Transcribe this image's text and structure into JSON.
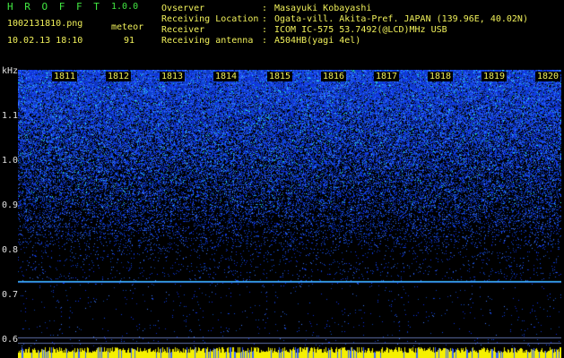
{
  "header": {
    "app_title": "H R O F F T",
    "app_version": "1.0.0",
    "file_name": "1002131810.png",
    "meteor_label": "meteor",
    "date_time": "10.02.13 18:10",
    "meteor_count": "91"
  },
  "info": [
    {
      "label": "Ovserver",
      "value": "Masayuki Kobayashi"
    },
    {
      "label": "Receiving Location",
      "value": "Ogata-vill. Akita-Pref. JAPAN (139.96E, 40.02N)"
    },
    {
      "label": "Receiver",
      "value": "ICOM IC-575 53.7492(@LCD)MHz USB"
    },
    {
      "label": "Receiving antenna",
      "value": "A504HB(yagi 4el)"
    }
  ],
  "separator": ":",
  "time_axis": [
    "1811",
    "1812",
    "1813",
    "1814",
    "1815",
    "1816",
    "1817",
    "1818",
    "1819",
    "1820"
  ],
  "freq_axis": {
    "unit": "kHz",
    "labels": [
      "1.1",
      "1.0",
      "0.9",
      "0.8",
      "0.7",
      "0.6"
    ]
  },
  "spectrogram": {
    "freq_range_khz": [
      0.59,
      1.2
    ],
    "carrier_khz": 0.742,
    "faint_lines_khz": [
      0.62,
      0.607
    ]
  },
  "colors": {
    "text_green": "#42e842",
    "text_yellow": "#f0f05a",
    "noise_blue": "#1a3bff",
    "carrier_cyan": "#40c0ff",
    "strip_yellow": "#f5f000"
  }
}
